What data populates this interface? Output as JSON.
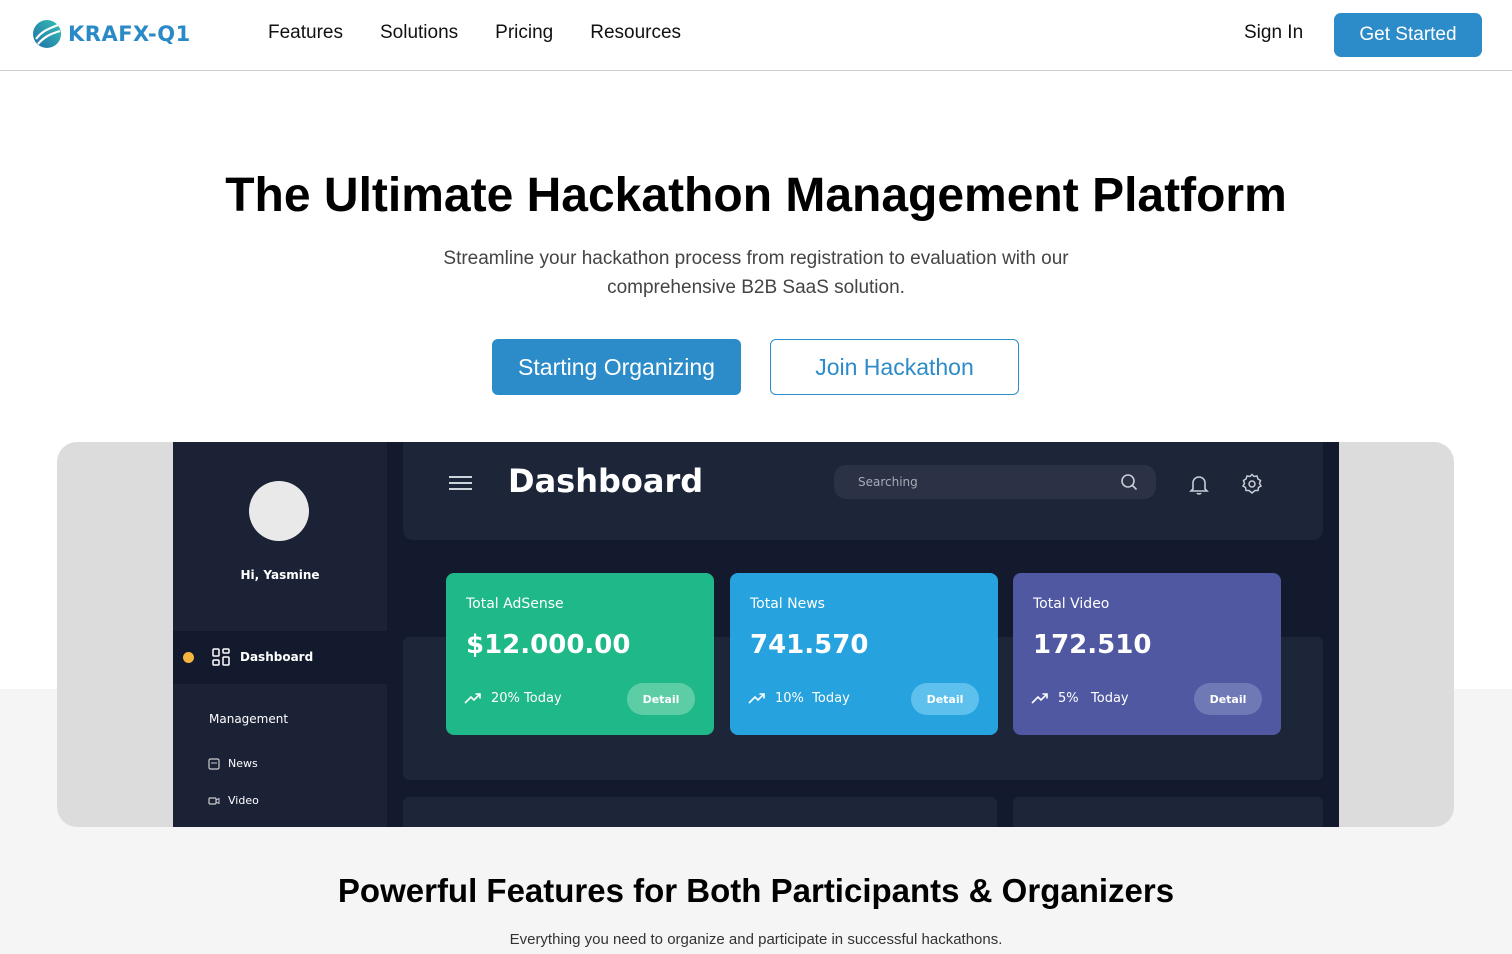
{
  "brand": {
    "name": "KRAFX-Q1",
    "accent": "#2c8bc9"
  },
  "nav": {
    "links": [
      "Features",
      "Solutions",
      "Pricing",
      "Resources"
    ],
    "sign_in": "Sign In",
    "get_started": "Get Started"
  },
  "hero": {
    "title": "The Ultimate Hackathon Management Platform",
    "subtitle_line1": "Streamline your hackathon process from registration to evaluation with our",
    "subtitle_line2": "comprehensive B2B SaaS solution.",
    "primary_cta": "Starting Organizing",
    "secondary_cta": "Join Hackathon"
  },
  "preview": {
    "greeting": "Hi, Yasmine",
    "active_item": "Dashboard",
    "section": "Management",
    "items": [
      {
        "label": "News",
        "icon": "news-icon"
      },
      {
        "label": "Video",
        "icon": "video-icon"
      }
    ],
    "title": "Dashboard",
    "search_placeholder": "Searching",
    "cards": [
      {
        "title": "Total AdSense",
        "value": "$12.000.00",
        "trend_pct": "20%",
        "trend_label": "Today",
        "button": "Detail",
        "color": "#1fb888",
        "button_color": "#5dcda6"
      },
      {
        "title": "Total News",
        "value": "741.570",
        "trend_pct": "10%",
        "trend_label": "Today",
        "button": "Detail",
        "color": "#26a3de",
        "button_color": "#5ec0ed"
      },
      {
        "title": "Total Video",
        "value": "172.510",
        "trend_pct": "5%",
        "trend_label": "Today",
        "button": "Detail",
        "color": "#4f58a0",
        "button_color": "#6f79b6"
      }
    ]
  },
  "features": {
    "title": "Powerful Features for Both Participants & Organizers",
    "subtitle": "Everything you need to organize and participate in successful hackathons."
  }
}
